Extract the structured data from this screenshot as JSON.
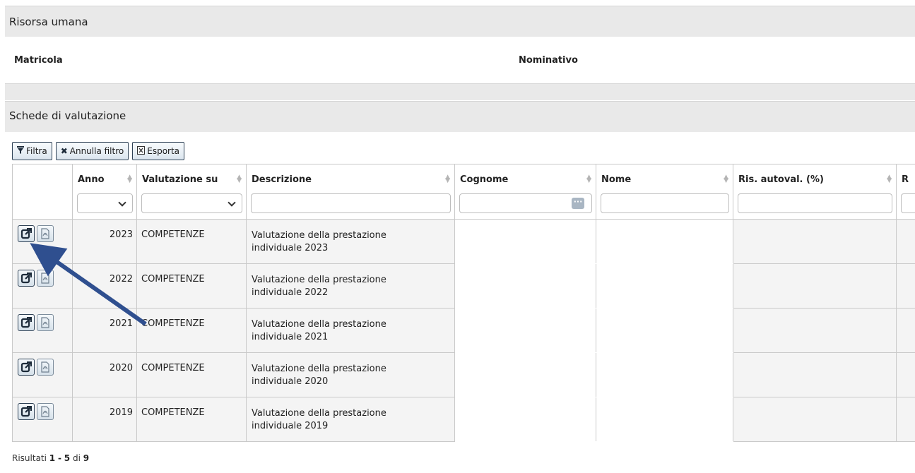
{
  "sections": {
    "risorsa": "Risorsa umana",
    "schede": "Schede di valutazione"
  },
  "fields": {
    "matricola": "Matricola",
    "nominativo": "Nominativo"
  },
  "toolbar": {
    "filtra": "Filtra",
    "annulla": "Annulla filtro",
    "esporta": "Esporta"
  },
  "icons": {
    "filter": "filter-icon",
    "clear": "x-icon",
    "export": "excel-icon",
    "open": "external-link-icon",
    "pdf": "pdf-icon"
  },
  "columns": [
    {
      "label": "Anno"
    },
    {
      "label": "Valutazione su"
    },
    {
      "label": "Descrizione"
    },
    {
      "label": "Cognome"
    },
    {
      "label": "Nome"
    },
    {
      "label": "Ris. autoval. (%)"
    },
    {
      "label": "R"
    }
  ],
  "rows": [
    {
      "anno": "2023",
      "valutazione": "COMPETENZE",
      "descrizione_1": "Valutazione della prestazione",
      "descrizione_2": "individuale 2023"
    },
    {
      "anno": "2022",
      "valutazione": "COMPETENZE",
      "descrizione_1": "Valutazione della prestazione",
      "descrizione_2": "individuale 2022"
    },
    {
      "anno": "2021",
      "valutazione": "COMPETENZE",
      "descrizione_1": "Valutazione della prestazione",
      "descrizione_2": "individuale 2021"
    },
    {
      "anno": "2020",
      "valutazione": "COMPETENZE",
      "descrizione_1": "Valutazione della prestazione",
      "descrizione_2": "individuale 2020"
    },
    {
      "anno": "2019",
      "valutazione": "COMPETENZE",
      "descrizione_1": "Valutazione della prestazione",
      "descrizione_2": "individuale 2019"
    }
  ],
  "pagination": {
    "prefix": "Risultati",
    "from": "1",
    "sep": "-",
    "to": "5",
    "of": "di",
    "total": "9"
  },
  "colors": {
    "annotation_arrow": "#2f4f8f"
  }
}
